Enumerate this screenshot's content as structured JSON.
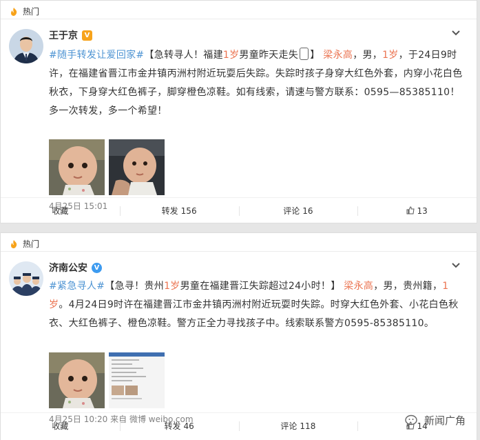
{
  "hot_label": "热门",
  "posts": [
    {
      "author": "王于京",
      "badge": "V",
      "topic": "#随手转发让爱回家#",
      "text_part1": "【急转寻人！福建",
      "age_red": "1岁",
      "text_part2": "男童昨天走失",
      "emoji": "📱",
      "text_part3": "】",
      "name_link": "梁永高",
      "text_part4": "，男，",
      "age_red2": "1岁",
      "text_part5": "，于24日9时许，在福建省晋江市金井镇丙洲村附近玩耍后失踪。失踪时孩子身穿大红色外套，内穿小花白色秋衣，下身穿大红色裤子，脚穿橙色凉鞋。如有线索，请速与警方联系：0595—85385110！多一次转发，多一个希望！",
      "time": "4月25日 15:01",
      "actions": {
        "fav": "收藏",
        "repost_label": "转发",
        "repost_count": "156",
        "comment_label": "评论",
        "comment_count": "16",
        "like_count": "13"
      }
    },
    {
      "author": "济南公安",
      "badge": "V",
      "topic": "#紧急寻人#",
      "text_part1": "【急寻！贵州",
      "age_red": "1岁",
      "text_part2": "男童在福建晋江失踪超过24小时！】",
      "name_link": "梁永高",
      "text_part4": "，男，贵州籍，",
      "age_red2": "1岁",
      "text_part5": "。4月24日9时许在福建晋江市金井镇丙洲村附近玩耍时失踪。时穿大红色外套、小花白色秋衣、大红色裤子、橙色凉鞋。警方正全力寻找孩子中。线索联系警方0595-85385110。",
      "time": "4月25日 10:20",
      "source_prefix": "来自",
      "source": "微博 weibo.com",
      "actions": {
        "fav": "收藏",
        "repost_label": "转发",
        "repost_count": "46",
        "comment_label": "评论",
        "comment_count": "118",
        "like_count": "14"
      }
    }
  ],
  "watermark": "新闻广角",
  "colors": {
    "topic_blue": "#4e94d3",
    "highlight_red": "#eb7350",
    "hot_orange": "#f7a31b"
  }
}
